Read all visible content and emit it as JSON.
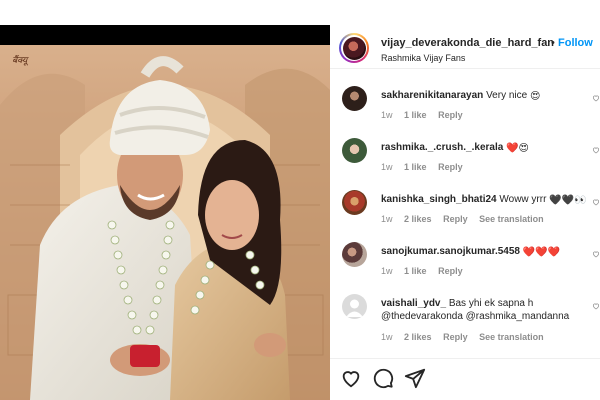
{
  "photo": {
    "watermark": "बैंक्यू"
  },
  "post_header": {
    "username": "vijay_deverakonda_die_hard_fan",
    "separator": "•",
    "follow_label": "Follow",
    "subtitle": "Rashmika Vijay Fans"
  },
  "comments": [
    {
      "user": "sakharenikitanarayan",
      "text": "Very nice",
      "emojis": "😍",
      "time": "1w",
      "likes": "1 like",
      "reply": "Reply",
      "translation": ""
    },
    {
      "user": "rashmika._.crush._.kerala",
      "text": "",
      "emojis": "❤️😍",
      "time": "1w",
      "likes": "1 like",
      "reply": "Reply",
      "translation": ""
    },
    {
      "user": "kanishka_singh_bhati24",
      "text": "Woww yrrr",
      "emojis": "🖤🖤👀",
      "time": "1w",
      "likes": "2 likes",
      "reply": "Reply",
      "translation": "See translation"
    },
    {
      "user": "sanojkumar.sanojkumar.5458",
      "text": "",
      "emojis": "❤️❤️❤️",
      "time": "1w",
      "likes": "1 like",
      "reply": "Reply",
      "translation": ""
    },
    {
      "user": "vaishali_ydv_",
      "text": "Bas yhi ek sapna h @thedevarakonda @rashmika_mandanna",
      "emojis": "",
      "time": "1w",
      "likes": "2 likes",
      "reply": "Reply",
      "translation": "See translation"
    }
  ],
  "actions": {
    "like": "heart-icon",
    "comment": "comment-icon",
    "share": "share-icon"
  },
  "colors": {
    "link": "#0095f6",
    "text": "#262626",
    "muted": "#8e8e8e",
    "heart": "#ed4956"
  }
}
